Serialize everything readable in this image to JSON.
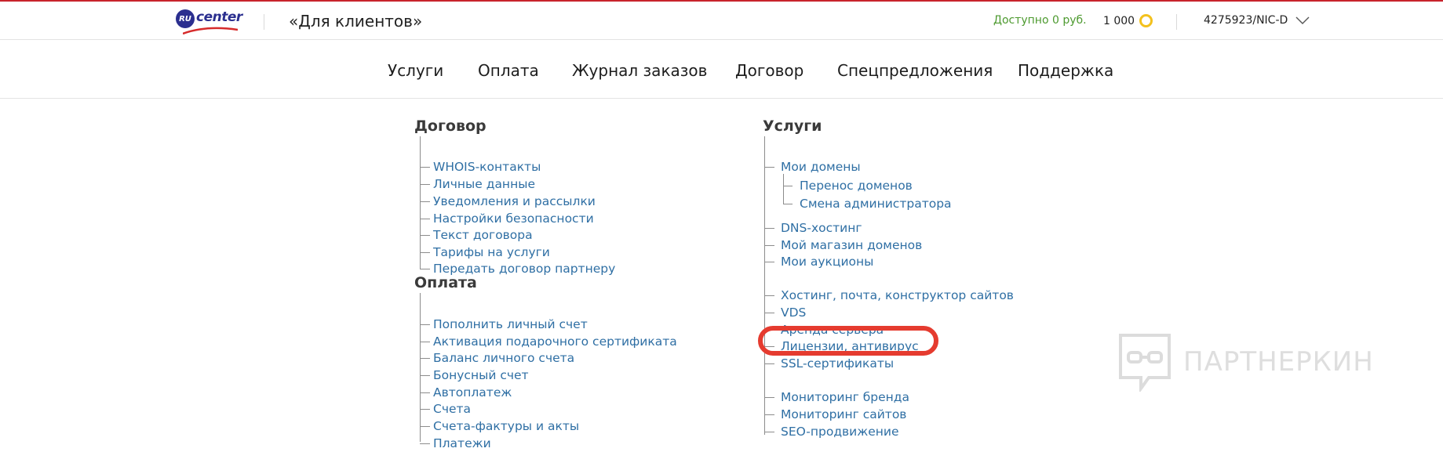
{
  "header": {
    "logo_badge": "RU",
    "logo_word": "center",
    "section_title": "«Для клиентов»",
    "balance_text": "Доступно 0 руб.",
    "bonus_amount": "1 000",
    "account_id": "4275923/NIC-D",
    "colors": {
      "accent_red": "#c8232c",
      "balance_green": "#4d9a2f",
      "coin_yellow": "#f3c11d",
      "brand_blue": "#2b2f8f"
    }
  },
  "nav": {
    "items": [
      "Услуги",
      "Оплата",
      "Журнал заказов",
      "Договор",
      "Спецпредложения",
      "Поддержка"
    ]
  },
  "contract": {
    "title": "Договор",
    "items": [
      "WHOIS-контакты",
      "Личные данные",
      "Уведомления и рассылки",
      "Настройки безопасности",
      "Текст договора",
      "Тарифы на услуги",
      "Передать договор партнеру"
    ]
  },
  "payment": {
    "title": "Оплата",
    "items": [
      "Пополнить личный счет",
      "Активация подарочного сертификата",
      "Баланс личного счета",
      "Бонусный счет",
      "Автоплатеж",
      "Счета",
      "Счета-фактуры и акты",
      "Платежи"
    ]
  },
  "services": {
    "title": "Услуги",
    "items": [
      "Мои домены",
      "Перенос доменов",
      "Смена администратора",
      "DNS-хостинг",
      "Мой магазин доменов",
      "Мои аукционы",
      "Хостинг, почта, конструктор сайтов",
      "VDS",
      "Аренда сервера",
      "Лицензии, антивирус",
      "SSL-сертификаты",
      "Мониторинг бренда",
      "Мониторинг сайтов",
      "SEO-продвижение"
    ],
    "highlight_color": "#e53b2f"
  },
  "watermark": {
    "text": "ПАРТНЕРКИН"
  }
}
